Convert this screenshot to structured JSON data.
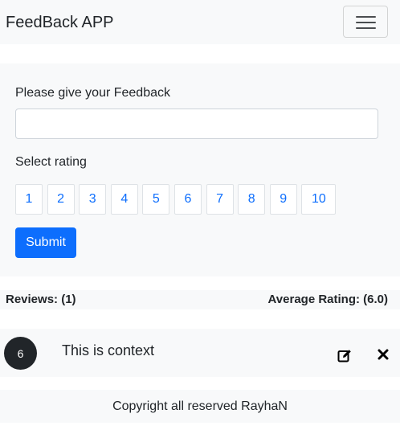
{
  "navbar": {
    "brand": "FeedBack APP",
    "toggler_icon": "hamburger-menu-icon"
  },
  "form": {
    "feedback_label": "Please give your Feedback",
    "feedback_value": "",
    "rating_label": "Select rating",
    "ratings": [
      "1",
      "2",
      "3",
      "4",
      "5",
      "6",
      "7",
      "8",
      "9",
      "10"
    ],
    "submit_label": "Submit"
  },
  "stats": {
    "reviews": "Reviews: (1)",
    "average": "Average Rating: (6.0)"
  },
  "reviews": [
    {
      "rating": "6",
      "text": "This is context",
      "edit_icon": "edit-icon",
      "delete_icon": "close-icon"
    }
  ],
  "footer": {
    "text": "Copyright all reserved RayhaN"
  },
  "colors": {
    "primary": "#0d6efd",
    "panel": "#f8f9fa",
    "dark": "#212529"
  }
}
